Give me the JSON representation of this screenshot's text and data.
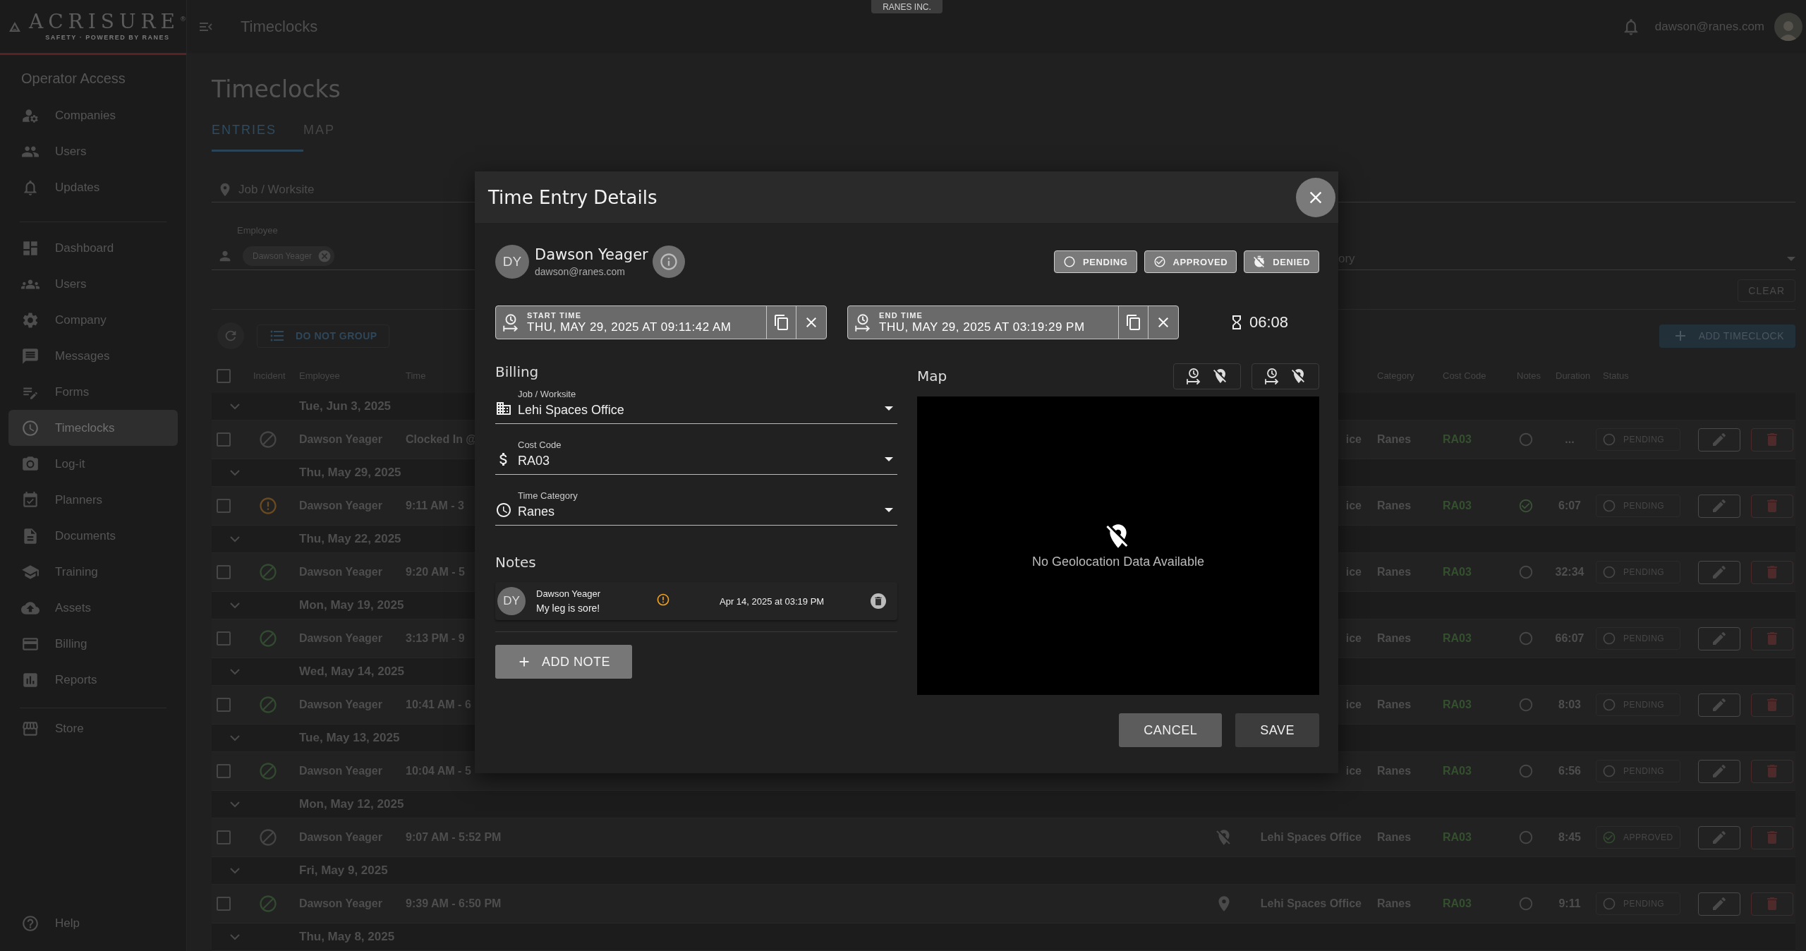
{
  "org_badge": "RANES INC.",
  "sidebar": {
    "brand": "ACRISURE$^{®}$",
    "tagline": "SAFETY · POWERED BY RANES",
    "sections": [
      {
        "title": "Operator Access",
        "items": [
          {
            "label": "Companies",
            "selected": false
          },
          {
            "label": "Users",
            "selected": false
          },
          {
            "label": "Updates",
            "selected": false
          }
        ]
      },
      {
        "items": [
          {
            "label": "Dashboard",
            "selected": false
          },
          {
            "label": "Users",
            "selected": false
          },
          {
            "label": "Company",
            "selected": false
          },
          {
            "label": "Messages",
            "selected": false
          },
          {
            "label": "Forms",
            "selected": false
          },
          {
            "label": "Timeclocks",
            "selected": true
          },
          {
            "label": "Log-it",
            "selected": false
          },
          {
            "label": "Planners",
            "selected": false
          },
          {
            "label": "Documents",
            "selected": false
          },
          {
            "label": "Training",
            "selected": false
          },
          {
            "label": "Assets",
            "selected": false
          },
          {
            "label": "Billing",
            "selected": false
          },
          {
            "label": "Reports",
            "selected": false
          }
        ]
      },
      {
        "items": [
          {
            "label": "Store",
            "selected": false
          }
        ]
      }
    ],
    "help": "Help"
  },
  "header": {
    "title": "Timeclocks",
    "user_email": "dawson@ranes.com"
  },
  "page": {
    "title": "Timeclocks",
    "tabs": [
      {
        "label": "ENTRIES",
        "selected": true
      },
      {
        "label": "MAP",
        "selected": false
      }
    ]
  },
  "filters": {
    "job_placeholder": "Job / Worksite",
    "employee_label": "Employee",
    "employee_chips": [
      "Dawson Yeager"
    ],
    "category_fragment": "ory",
    "clear": "CLEAR"
  },
  "toolbar": {
    "group_button": "DO NOT GROUP",
    "add_button": "ADD TIMECLOCK"
  },
  "table": {
    "all_checked": false,
    "columns_left": [
      "Incident",
      "Employee",
      "Time"
    ],
    "columns_right": [
      "Category",
      "Cost Code",
      "Notes",
      "Duration",
      "Status"
    ],
    "groups": [
      {
        "date": "Tue, Jun 3, 2025",
        "entries": [
          {
            "kind": "none",
            "checked": false,
            "employee": "Dawson Yeager",
            "time": "Clocked In @",
            "job": "ice",
            "category": "Ranes",
            "cost_code": "RA03",
            "notes_reviewed": false,
            "duration": "...",
            "status": {
              "kind": "pending",
              "label": "PENDING"
            }
          }
        ]
      },
      {
        "date": "Thu, May 29, 2025",
        "entries": [
          {
            "kind": "warning",
            "checked": false,
            "employee": "Dawson Yeager",
            "time": "9:11 AM - 3",
            "job": "ice",
            "category": "Ranes",
            "cost_code": "RA03",
            "notes_reviewed": true,
            "duration": "6:07",
            "status": {
              "kind": "pending",
              "label": "PENDING"
            }
          }
        ]
      },
      {
        "date": "Thu, May 22, 2025",
        "entries": [
          {
            "kind": "clear",
            "checked": false,
            "employee": "Dawson Yeager",
            "time": "9:20 AM - 5",
            "job": "ice",
            "category": "Ranes",
            "cost_code": "RA03",
            "notes_reviewed": false,
            "duration": "32:34",
            "status": {
              "kind": "pending",
              "label": "PENDING"
            }
          }
        ]
      },
      {
        "date": "Mon, May 19, 2025",
        "entries": [
          {
            "kind": "clear",
            "checked": false,
            "employee": "Dawson Yeager",
            "time": "3:13 PM - 9",
            "job": "ice",
            "category": "Ranes",
            "cost_code": "RA03",
            "notes_reviewed": false,
            "duration": "66:07",
            "status": {
              "kind": "pending",
              "label": "PENDING"
            }
          }
        ]
      },
      {
        "date": "Wed, May 14, 2025",
        "entries": [
          {
            "kind": "clear",
            "checked": false,
            "employee": "Dawson Yeager",
            "time": "10:41 AM - 6",
            "job": "ice",
            "category": "Ranes",
            "cost_code": "RA03",
            "notes_reviewed": false,
            "duration": "8:03",
            "status": {
              "kind": "pending",
              "label": "PENDING"
            }
          }
        ]
      },
      {
        "date": "Tue, May 13, 2025",
        "entries": [
          {
            "kind": "clear",
            "checked": false,
            "employee": "Dawson Yeager",
            "time": "10:04 AM - 5",
            "job": "ice",
            "category": "Ranes",
            "cost_code": "RA03",
            "notes_reviewed": false,
            "duration": "6:56",
            "status": {
              "kind": "pending",
              "label": "PENDING"
            }
          }
        ]
      },
      {
        "date": "Mon, May 12, 2025",
        "entries": [
          {
            "kind": "none",
            "checked": false,
            "employee": "Dawson Yeager",
            "time": "9:07 AM - 5:52 PM",
            "geolocated": false,
            "job": "Lehi Spaces Office",
            "category": "Ranes",
            "cost_code": "RA03",
            "notes_reviewed": false,
            "duration": "8:45",
            "status": {
              "kind": "approved",
              "label": "APPROVED"
            }
          }
        ]
      },
      {
        "date": "Fri, May 9, 2025",
        "entries": [
          {
            "kind": "clear",
            "checked": false,
            "employee": "Dawson Yeager",
            "time": "9:39 AM - 6:50 PM",
            "geolocated": true,
            "job": "Lehi Spaces Office",
            "category": "Ranes",
            "cost_code": "RA03",
            "notes_reviewed": false,
            "duration": "9:11",
            "status": {
              "kind": "pending",
              "label": "PENDING"
            }
          }
        ]
      },
      {
        "date": "Thu, May 8, 2025"
      }
    ]
  },
  "modal": {
    "title": "Time Entry Details",
    "user": {
      "initials": "DY",
      "name": "Dawson Yeager",
      "email": "dawson@ranes.com"
    },
    "statuses": [
      {
        "kind": "pending",
        "label": "PENDING"
      },
      {
        "kind": "approved",
        "label": "APPROVED"
      },
      {
        "kind": "denied",
        "label": "DENIED"
      }
    ],
    "start": {
      "label": "START TIME",
      "value": "THU, MAY 29, 2025 AT 09:11:42 AM"
    },
    "end": {
      "label": "END TIME",
      "value": "THU, MAY 29, 2025 AT 03:19:29 PM"
    },
    "duration": "06:08",
    "billing": {
      "title": "Billing",
      "fields": [
        {
          "label": "Job / Worksite",
          "value": "Lehi Spaces Office"
        },
        {
          "label": "Cost Code",
          "value": "RA03"
        },
        {
          "label": "Time Category",
          "value": "Ranes"
        }
      ]
    },
    "notes": {
      "title": "Notes",
      "items": [
        {
          "initials": "DY",
          "author": "Dawson Yeager",
          "flagged": true,
          "date": "Apr 14, 2025 at 03:19 PM",
          "text": "My leg is sore!"
        }
      ],
      "add_button": "ADD NOTE"
    },
    "map": {
      "title": "Map",
      "empty_text": "No Geolocation Data Available"
    },
    "actions": {
      "cancel": "CANCEL",
      "save": "SAVE"
    }
  }
}
